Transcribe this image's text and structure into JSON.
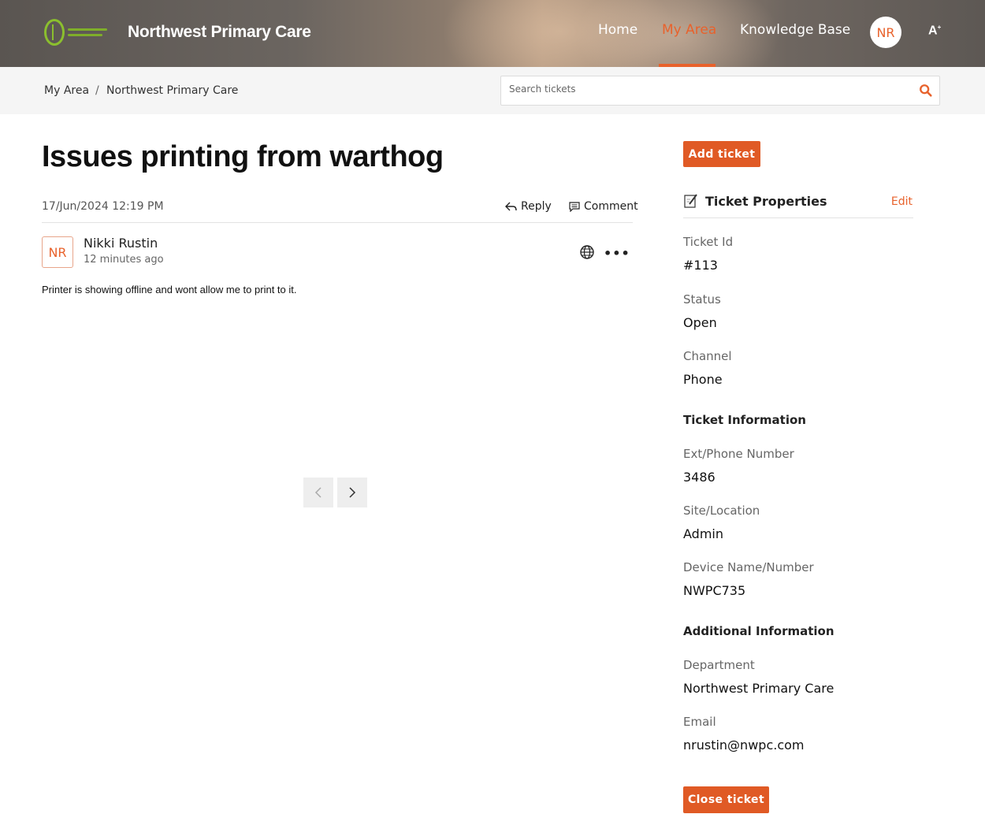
{
  "header": {
    "site_title": "Northwest Primary Care",
    "nav": {
      "home": "Home",
      "my_area": "My Area",
      "knowledge_base": "Knowledge Base"
    },
    "user_initials": "NR",
    "accessibility_label": "A"
  },
  "breadcrumb": {
    "items": [
      "My Area",
      "Northwest Primary Care"
    ],
    "separator": "/"
  },
  "search": {
    "placeholder": "Search tickets",
    "value": ""
  },
  "ticket": {
    "title": "Issues printing from warthog",
    "date": "17/Jun/2024 12:19 PM",
    "actions": {
      "reply": "Reply",
      "comment": "Comment"
    },
    "message": {
      "author_initials": "NR",
      "author": "Nikki Rustin",
      "time": "12 minutes ago",
      "more_label": "•••",
      "body": "Printer is showing offline and wont allow me to print to it."
    }
  },
  "sidebar": {
    "add_ticket_label": "Add ticket",
    "properties_title": "Ticket Properties",
    "edit_label": "Edit",
    "fields": {
      "ticket_id": {
        "label": "Ticket Id",
        "value": "#113"
      },
      "status": {
        "label": "Status",
        "value": "Open"
      },
      "channel": {
        "label": "Channel",
        "value": "Phone"
      }
    },
    "ticket_information": {
      "title": "Ticket Information",
      "ext_phone": {
        "label": "Ext/Phone Number",
        "value": "3486"
      },
      "site_location": {
        "label": "Site/Location",
        "value": "Admin"
      },
      "device": {
        "label": "Device Name/Number",
        "value": "NWPC735"
      }
    },
    "additional_information": {
      "title": "Additional Information",
      "department": {
        "label": "Department",
        "value": "Northwest Primary Care"
      },
      "email": {
        "label": "Email",
        "value": "nrustin@nwpc.com"
      }
    },
    "close_ticket_label": "Close ticket"
  },
  "colors": {
    "accent": "#e8622c",
    "button": "#e05a25",
    "logo_green": "#8bbf2e"
  }
}
